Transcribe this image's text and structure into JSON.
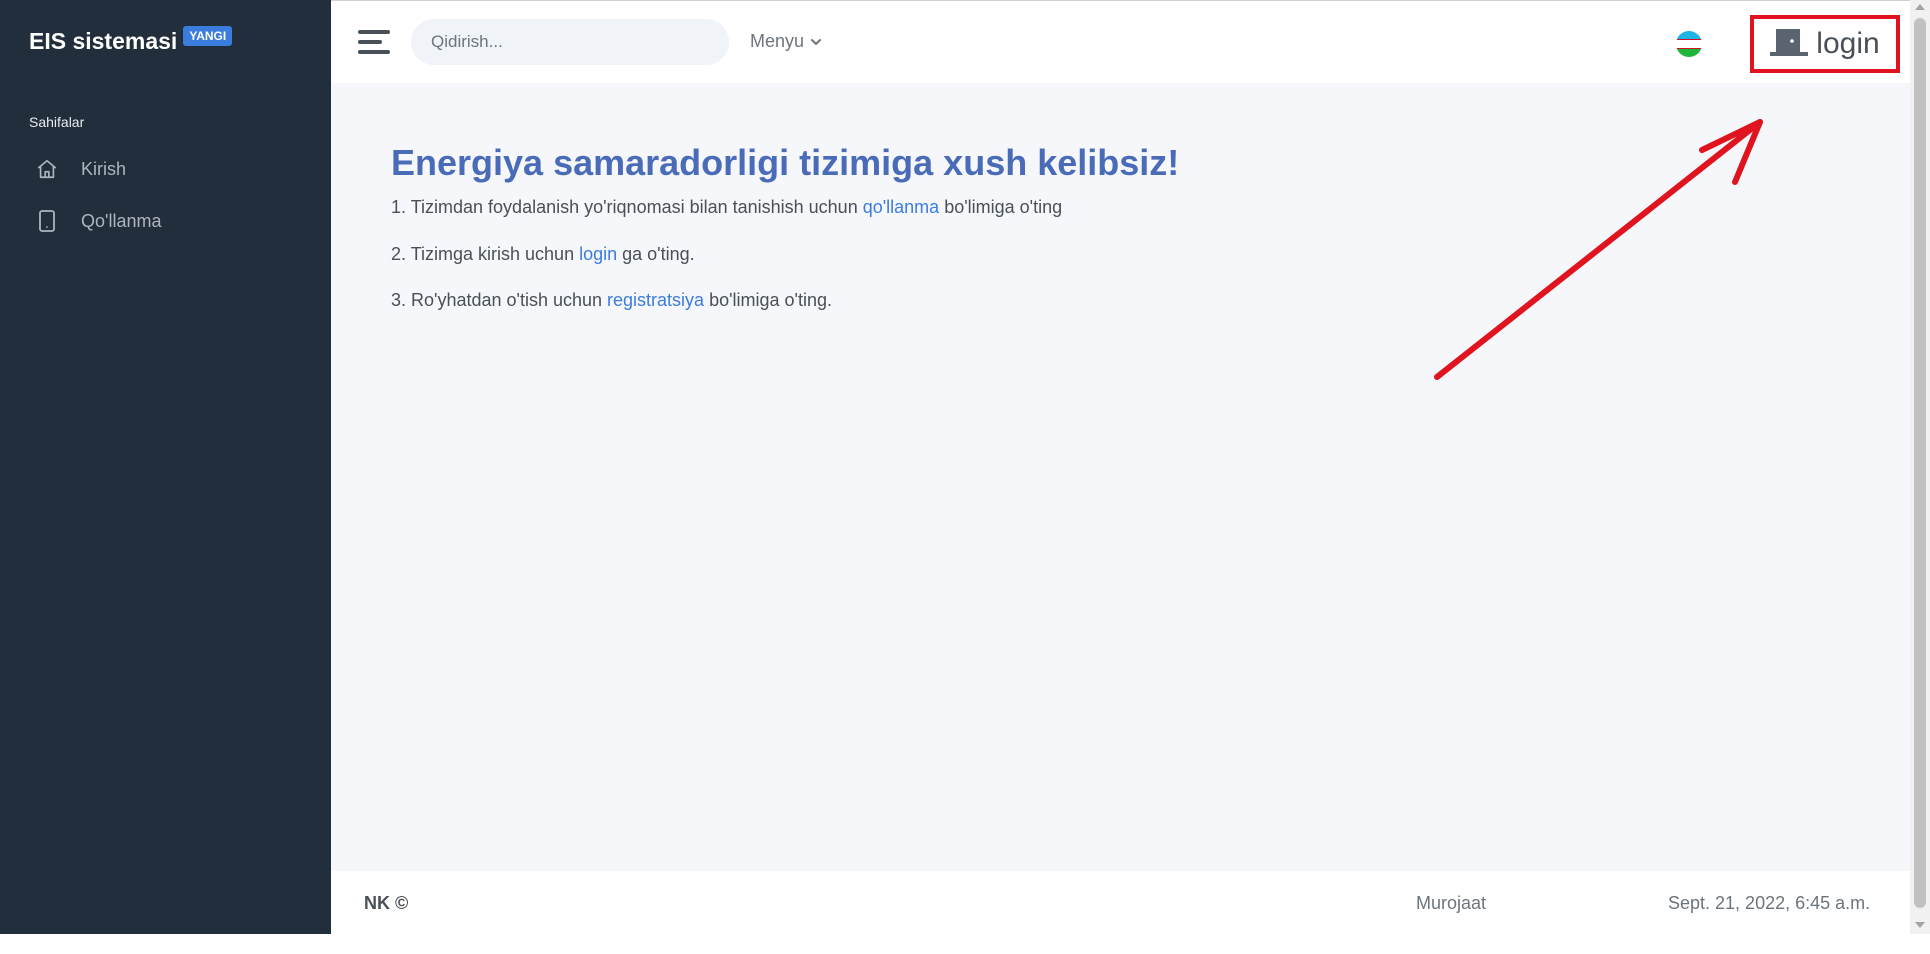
{
  "brand": {
    "name": "EIS sistemasi",
    "badge": "YANGI"
  },
  "sidebar": {
    "header": "Sahifalar",
    "items": [
      {
        "label": "Kirish",
        "icon": "home-icon"
      },
      {
        "label": "Qo'llanma",
        "icon": "tablet-icon"
      }
    ]
  },
  "navbar": {
    "search_placeholder": "Qidirish...",
    "menu_label": "Menyu",
    "language_flag": "uzbekistan-flag",
    "login_label": "login"
  },
  "main": {
    "title": "Energiya samaradorligi tizimiga xush kelibsiz!",
    "steps": [
      {
        "prefix": "1. Tizimdan foydalanish yo'riqnomasi bilan tanishish uchun ",
        "link": "qo'llanma",
        "suffix": " bo'limiga o'ting"
      },
      {
        "prefix": "2. Tizimga kirish uchun ",
        "link": "login",
        "suffix": " ga o'ting."
      },
      {
        "prefix": "3. Ro'yhatdan o'tish uchun ",
        "link": "registratsiya",
        "suffix": " bo'limiga o'ting."
      }
    ]
  },
  "footer": {
    "left": "NK ©",
    "link": "Murojaat",
    "date": "Sept. 21, 2022, 6:45 a.m."
  },
  "colors": {
    "sidebar_bg": "#222e3c",
    "accent": "#3b7ddd",
    "title": "#4a6bb8",
    "annotation_red": "#e0141f"
  }
}
